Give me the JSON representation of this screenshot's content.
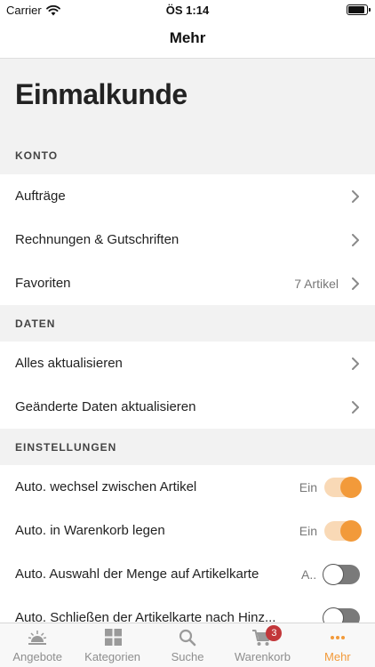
{
  "status_bar": {
    "carrier": "Carrier",
    "time": "ÖS 1:14",
    "battery_level": 0.95
  },
  "nav": {
    "title": "Mehr"
  },
  "page": {
    "large_title": "Einmalkunde"
  },
  "sections": {
    "konto": {
      "header": "KONTO",
      "items": [
        {
          "label": "Aufträge"
        },
        {
          "label": "Rechnungen & Gutschriften"
        },
        {
          "label": "Favoriten",
          "value": "7 Artikel"
        }
      ]
    },
    "daten": {
      "header": "DATEN",
      "items": [
        {
          "label": "Alles aktualisieren"
        },
        {
          "label": "Geänderte Daten aktualisieren"
        }
      ]
    },
    "einstellungen": {
      "header": "EINSTELLUNGEN",
      "items": [
        {
          "label": "Auto. wechsel zwischen Artikel",
          "value": "Ein",
          "on": true
        },
        {
          "label": "Auto. in Warenkorb legen",
          "value": "Ein",
          "on": true
        },
        {
          "label": "Auto. Auswahl der Menge auf Artikelkarte",
          "value": "A...",
          "on": false
        },
        {
          "label": "Auto. Schließen der Artikelkarte nach Hinz...",
          "value": "",
          "on": false
        }
      ]
    }
  },
  "tab_bar": {
    "tabs": [
      {
        "label": "Angebote",
        "icon": "offers-icon"
      },
      {
        "label": "Kategorien",
        "icon": "grid-icon"
      },
      {
        "label": "Suche",
        "icon": "search-icon"
      },
      {
        "label": "Warenkorb",
        "icon": "cart-icon",
        "badge": "3"
      },
      {
        "label": "Mehr",
        "icon": "more-icon",
        "active": true
      }
    ]
  },
  "colors": {
    "accent": "#f29a3a",
    "badge": "#c2373a"
  }
}
